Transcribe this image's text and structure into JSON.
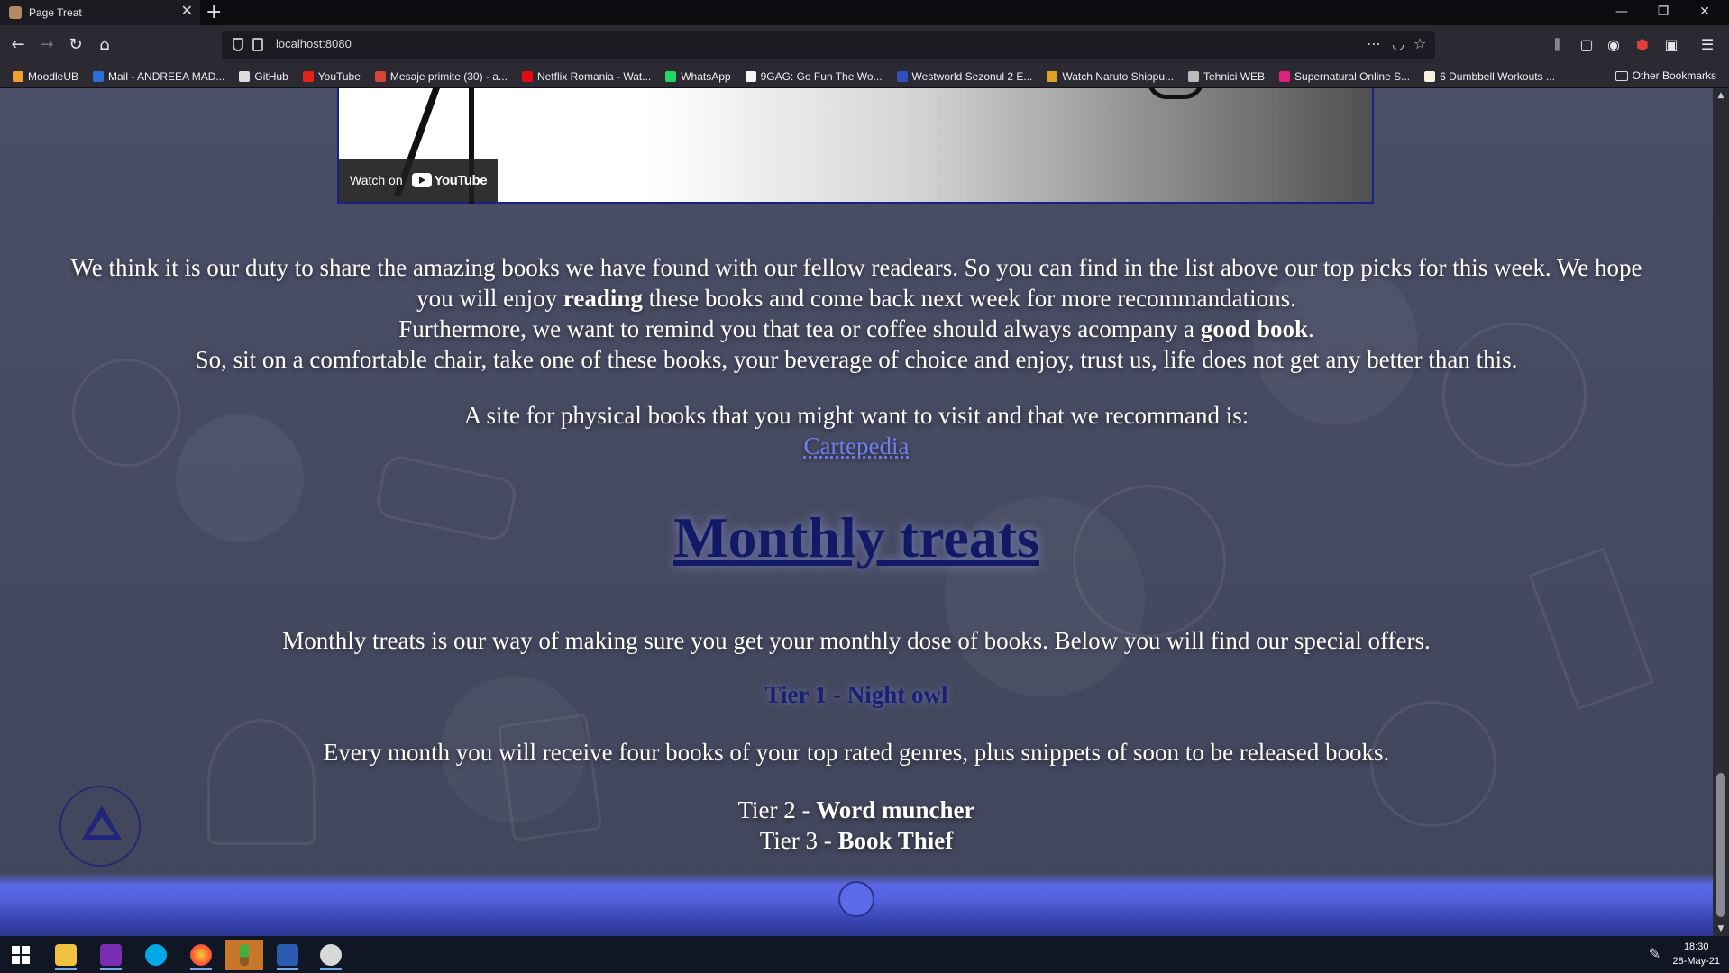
{
  "browser": {
    "tab_title": "Page Treat",
    "tab_close": "✕",
    "new_tab": "+",
    "url": "localhost:8080",
    "window_controls": [
      "—",
      "❐",
      "✕"
    ],
    "bookmarks": [
      {
        "label": "MoodleUB",
        "color": "#f0a030"
      },
      {
        "label": "Mail - ANDREEA MAD...",
        "color": "#2a6fd4"
      },
      {
        "label": "GitHub",
        "color": "#dddddd"
      },
      {
        "label": "YouTube",
        "color": "#e62117"
      },
      {
        "label": "Mesaje primite (30) - a...",
        "color": "#d44638"
      },
      {
        "label": "Netflix Romania - Wat...",
        "color": "#e50914"
      },
      {
        "label": "WhatsApp",
        "color": "#25d366"
      },
      {
        "label": "9GAG: Go Fun The Wo...",
        "color": "#f5f5f5"
      },
      {
        "label": "Westworld Sezonul 2 E...",
        "color": "#3050c0"
      },
      {
        "label": "Watch Naruto Shippu...",
        "color": "#e0a020"
      },
      {
        "label": "Tehnici WEB",
        "color": "#bbbbbb"
      },
      {
        "label": "Supernatural Online S...",
        "color": "#e02080"
      },
      {
        "label": "6 Dumbbell Workouts ...",
        "color": "#f5f0e0"
      }
    ],
    "other_bookmarks": "Other Bookmarks"
  },
  "video": {
    "watch_on": "Watch on",
    "youtube": "YouTube"
  },
  "intro": {
    "line1": "We think it is our duty to share the amazing books we have found with our fellow readears. So you can find in the list above our top picks for this week. We hope",
    "line2_a": "you will enjoy ",
    "line2_bold": "reading",
    "line2_b": " these books and come back next week for more recommandations.",
    "line3_a": "Furthermore, we want to remind you that tea or coffee should always acompany a ",
    "line3_bold": "good book",
    "line3_b": ".",
    "line4": "So, sit on a comfortable chair, take one of these books, your beverage of choice and enjoy, trust us, life does not get any better than this."
  },
  "site": {
    "text": "A site for physical books that you might want to visit and that we recommand is:",
    "link": "Cartepedia"
  },
  "monthly": {
    "title": "Monthly treats",
    "desc": "Monthly treats is our way of making sure you get your monthly dose of books. Below you will find our special offers.",
    "tier1": "Tier 1 - Night owl",
    "tier1_desc": "Every month you will receive four books of your top rated genres, plus snippets of soon to be released books.",
    "tier2_prefix": "Tier 2 - ",
    "tier2_name": "Word muncher",
    "tier3_prefix": "Tier 3 - ",
    "tier3_name": "Book Thief"
  },
  "taskbar": {
    "time": "18:30",
    "date": "28-May-21"
  }
}
